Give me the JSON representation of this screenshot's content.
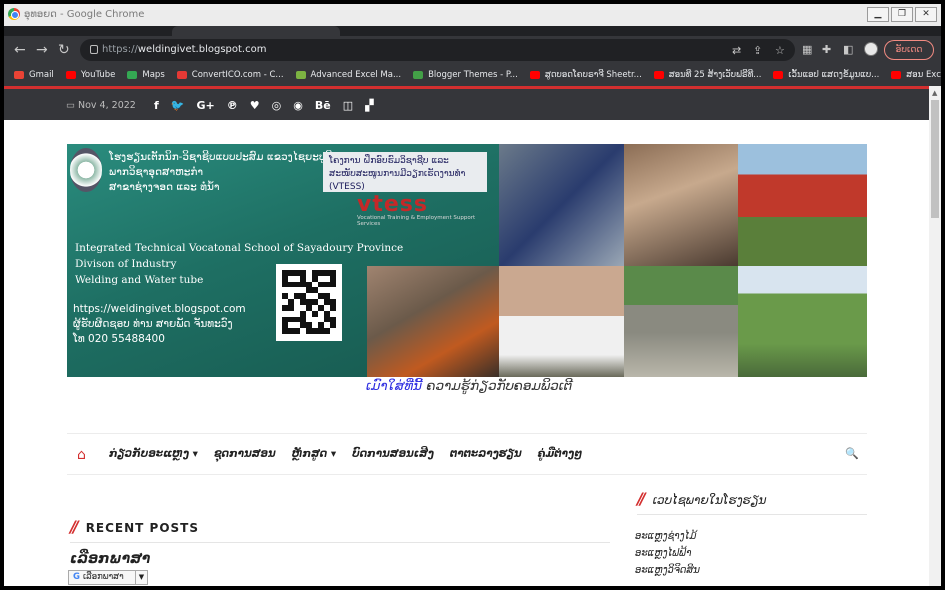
{
  "browser": {
    "window_title": "ອຸທອຍດ - Google Chrome",
    "url_prefix": "https://",
    "url_host": "weldingivet.blogspot.com",
    "update_label": "ອັບເດດ"
  },
  "bookmarks": [
    {
      "label": "Gmail",
      "color": "#ea4335"
    },
    {
      "label": "YouTube",
      "color": "#ff0000"
    },
    {
      "label": "Maps",
      "color": "#34a853"
    },
    {
      "label": "ConvertICO.com - C...",
      "color": "#e53935"
    },
    {
      "label": "Advanced Excel Ma...",
      "color": "#7cb342"
    },
    {
      "label": "Blogger Themes - P...",
      "color": "#43a047"
    },
    {
      "label": "ສູດບອດໂຄບຣາຈີ Sheetr...",
      "color": "#ff0000"
    },
    {
      "label": "ສອນທີ 25 ສ້າງເວັບຟຣີທີ...",
      "color": "#ff0000"
    },
    {
      "label": "ເວັ້ນແອປ ແສດງຂໍ້ມູນແບ...",
      "color": "#ff0000"
    },
    {
      "label": "ສອນ Excel: VLOOKU...",
      "color": "#ff0000"
    }
  ],
  "topbar": {
    "date": "Nov 4, 2022",
    "social_icons": [
      "facebook-icon",
      "twitter-icon",
      "google-plus-icon",
      "pinterest-icon",
      "heart-icon",
      "dribbble-icon",
      "rss-icon",
      "behance-icon",
      "instagram-icon",
      "delicious-icon"
    ]
  },
  "banner": {
    "org_lines": [
      "ໂຮງຮຽນເຕັກນິກ-ວິຊາຊີບແບບປະສົມ ແຂວງໄຊຍະບູລີ",
      "ພາກວິຊາອຸດສາຫະກຳ",
      "ສາຂາຊ່າງຈອດ ແລະ ທໍ່ນ້ຳ"
    ],
    "tag_text": "ໂຄງການ ຝຶກອົບຮົມວິຊາຊີບ ແລະ ສະໜັບສະໜູນການມີວຽກເຮັດງານທຳ (VTESS)",
    "logo": "vtess",
    "logo_sub": "Vocational Training & Employment Support Services",
    "en_lines": [
      "Integrated Technical Vocatonal School of Sayadoury Province",
      "Divison of Industry",
      "Welding and Water tube"
    ],
    "contact_lines": [
      "https://weldingivet.blogspot.com",
      "ຜູ້ຮັບຜິດຊອບ ທ່ານ ສາຍພັດ ຈັນທະວົງ",
      "ໂທ 020 55488400"
    ]
  },
  "site_title": {
    "highlight": "ເມົາໃສ່ທີ່ນີ້",
    "rest": " ຄວາມຮູ້ກ່ຽວກັບຄອມພິວເຕີ"
  },
  "nav": {
    "items": [
      "ກ່ຽວກັບອະແຫຼງ ▾",
      "ຊຸດການສອນ",
      "ຫຼັກສູດ ▾",
      "ບົດການສອນເສີງ",
      "ຕາຕະລາງຮຽນ",
      "ຄູ່ມືຕ່າງໆ"
    ]
  },
  "widgets": {
    "recent_posts": "RECENT POSTS",
    "language_title": "ເລືອກພາສາ",
    "language_select": "ເລືອກພາສາ",
    "side_title": "ເວບໄຊພາຍໃນໂຮງຮຽນ",
    "side_links": [
      "ອະແຫຼງຊ່າງໄມ້",
      "ອະແຫຼງໄຟຟ້າ",
      "ອະແຫຼງວິຈິດສິນ"
    ]
  }
}
